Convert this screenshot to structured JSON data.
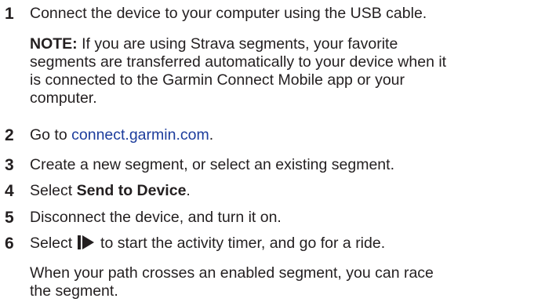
{
  "steps": [
    {
      "number": "1",
      "text": "Connect the device to your computer using the USB cable.",
      "note": {
        "label": "NOTE:",
        "lines": [
          " If you are using Strava segments, your favorite",
          "segments are transferred automatically to your device when it",
          "is connected to the Garmin Connect Mobile app or your",
          "computer."
        ]
      }
    },
    {
      "number": "2",
      "before": "Go to ",
      "link": "connect.garmin.com",
      "after": "."
    },
    {
      "number": "3",
      "text": "Create a new segment, or select an existing segment."
    },
    {
      "number": "4",
      "before": "Select ",
      "bold": "Send to Device",
      "after": "."
    },
    {
      "number": "5",
      "text": "Disconnect the device, and turn it on."
    },
    {
      "number": "6",
      "before": "Select ",
      "icon": "start-stop-icon",
      "after": " to start the activity timer, and go for a ride.",
      "result_lines": [
        "When your path crosses an enabled segment, you can race",
        "the segment."
      ]
    }
  ],
  "colors": {
    "text": "#231f20",
    "link": "#1c3c9c"
  }
}
